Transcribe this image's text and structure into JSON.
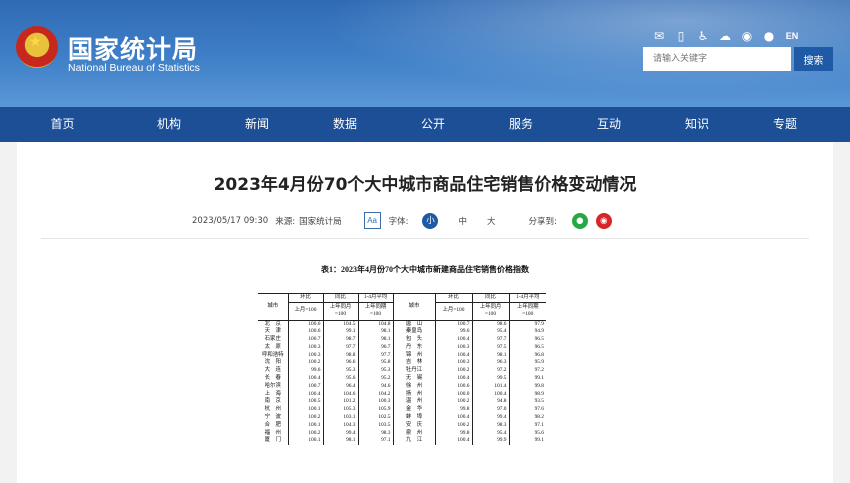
{
  "header": {
    "logo_cn": "国家统计局",
    "logo_en": "National Bureau of Statistics",
    "search_placeholder": "请输入关键字",
    "search_button": "搜索",
    "lang": "EN",
    "top_icons": [
      "mail-icon",
      "phone-icon",
      "accessibility-icon",
      "cloud-icon",
      "weibo-icon",
      "wechat-icon"
    ]
  },
  "nav": [
    "首页",
    "机构",
    "新闻",
    "数据",
    "公开",
    "服务",
    "互动",
    "知识",
    "专题"
  ],
  "article": {
    "title": "2023年4月份70个大中城市商品住宅销售价格变动情况",
    "date": "2023/05/17 09:30",
    "source_label": "来源:",
    "source": "国家统计局",
    "aa": "Aa",
    "font_label": "字体:",
    "font_sizes": [
      "小",
      "中",
      "大"
    ],
    "share_label": "分享到:"
  },
  "table": {
    "caption": "表1：2023年4月份70个大中城市新建商品住宅销售价格指数",
    "header": {
      "city": "城市",
      "mom": "环比",
      "yoy": "同比",
      "avg": "1-4月平均",
      "mom_base": "上月=100",
      "yoy_base": "上年同月",
      "yoy_base2": "=100",
      "avg_base": "上年同期",
      "avg_base2": "=100"
    },
    "rows": [
      {
        "c1": "北　京",
        "m1": "100.6",
        "y1": "104.5",
        "a1": "104.8",
        "c2": "唐　山",
        "m2": "100.7",
        "y2": "98.6",
        "a2": "97.9"
      },
      {
        "c1": "天　津",
        "m1": "100.6",
        "y1": "99.1",
        "a1": "98.1",
        "c2": "秦皇岛",
        "m2": "99.6",
        "y2": "95.4",
        "a2": "94.9"
      },
      {
        "c1": "石家庄",
        "m1": "100.7",
        "y1": "98.7",
        "a1": "98.1",
        "c2": "包　头",
        "m2": "100.4",
        "y2": "97.7",
        "a2": "96.5"
      },
      {
        "c1": "太　原",
        "m1": "100.3",
        "y1": "97.7",
        "a1": "96.7",
        "c2": "丹　东",
        "m2": "100.3",
        "y2": "97.5",
        "a2": "96.5"
      },
      {
        "c1": "呼和浩特",
        "m1": "100.3",
        "y1": "98.8",
        "a1": "97.7",
        "c2": "锦　州",
        "m2": "100.4",
        "y2": "98.1",
        "a2": "96.8"
      },
      {
        "c1": "沈　阳",
        "m1": "100.2",
        "y1": "96.6",
        "a1": "95.8",
        "c2": "吉　林",
        "m2": "100.3",
        "y2": "96.3",
        "a2": "95.9"
      },
      {
        "c1": "大　连",
        "m1": "99.6",
        "y1": "95.3",
        "a1": "95.3",
        "c2": "牡丹江",
        "m2": "100.2",
        "y2": "97.2",
        "a2": "97.2"
      },
      {
        "c1": "长　春",
        "m1": "100.4",
        "y1": "95.6",
        "a1": "95.2",
        "c2": "无　锡",
        "m2": "100.4",
        "y2": "99.5",
        "a2": "99.1"
      },
      {
        "c1": "哈尔滨",
        "m1": "100.7",
        "y1": "96.4",
        "a1": "94.6",
        "c2": "徐　州",
        "m2": "100.6",
        "y2": "101.4",
        "a2": "99.8"
      },
      {
        "c1": "上　海",
        "m1": "100.4",
        "y1": "104.6",
        "a1": "104.2",
        "c2": "扬　州",
        "m2": "100.0",
        "y2": "100.4",
        "a2": "98.9"
      },
      {
        "c1": "南　京",
        "m1": "100.5",
        "y1": "101.2",
        "a1": "100.3",
        "c2": "温　州",
        "m2": "100.2",
        "y2": "94.8",
        "a2": "93.5"
      },
      {
        "c1": "杭　州",
        "m1": "100.1",
        "y1": "105.3",
        "a1": "105.9",
        "c2": "金　华",
        "m2": "99.8",
        "y2": "97.0",
        "a2": "97.6"
      },
      {
        "c1": "宁　波",
        "m1": "100.2",
        "y1": "103.1",
        "a1": "102.5",
        "c2": "蚌　埠",
        "m2": "100.4",
        "y2": "99.4",
        "a2": "98.2"
      },
      {
        "c1": "合　肥",
        "m1": "100.1",
        "y1": "104.3",
        "a1": "103.5",
        "c2": "安　庆",
        "m2": "100.2",
        "y2": "98.3",
        "a2": "97.1"
      },
      {
        "c1": "福　州",
        "m1": "100.2",
        "y1": "99.4",
        "a1": "98.3",
        "c2": "泉　州",
        "m2": "99.8",
        "y2": "95.4",
        "a2": "95.6"
      },
      {
        "c1": "厦　门",
        "m1": "100.1",
        "y1": "98.1",
        "a1": "97.1",
        "c2": "九　江",
        "m2": "100.4",
        "y2": "99.9",
        "a2": "99.1"
      }
    ]
  }
}
